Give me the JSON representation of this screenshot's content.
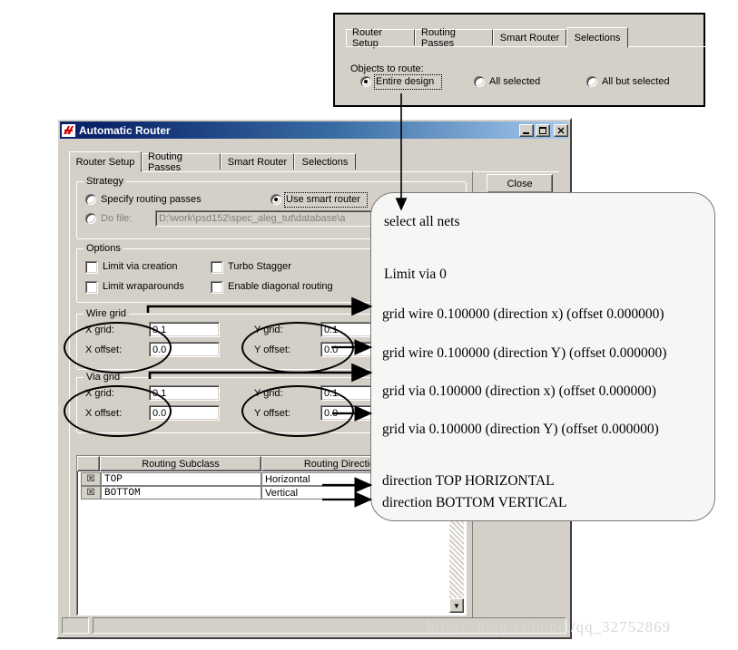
{
  "top_panel": {
    "tabs": [
      {
        "label": "Router Setup",
        "active": false
      },
      {
        "label": "Routing Passes",
        "active": false
      },
      {
        "label": "Smart Router",
        "active": false
      },
      {
        "label": "Selections",
        "active": true
      }
    ],
    "group_label": "Objects to route:",
    "options": [
      {
        "label": "Entire design",
        "selected": true
      },
      {
        "label": "All selected",
        "selected": false
      },
      {
        "label": "All but selected",
        "selected": false
      }
    ]
  },
  "dialog": {
    "title": "Automatic Router",
    "icon": "router-app-icon",
    "window_buttons": {
      "minimize": "minimize-icon",
      "maximize": "maximize-icon",
      "close": "close-icon"
    },
    "tabs": [
      {
        "label": "Router Setup",
        "active": true
      },
      {
        "label": "Routing Passes",
        "active": false
      },
      {
        "label": "Smart Router",
        "active": false
      },
      {
        "label": "Selections",
        "active": false
      }
    ],
    "close_button": "Close",
    "strategy": {
      "legend": "Strategy",
      "specify_routing_passes": "Specify routing passes",
      "use_smart_router": "Use smart router",
      "do_file_label": "Do file:",
      "do_file_value": "D:\\work\\psd152\\spec_aleg_tut\\database\\a",
      "selected": "use_smart_router"
    },
    "options": {
      "legend": "Options",
      "items": [
        {
          "label": "Limit via creation",
          "checked": false
        },
        {
          "label": "Turbo Stagger",
          "checked": false
        },
        {
          "label": "Limit wraparounds",
          "checked": false
        },
        {
          "label": "Enable diagonal routing",
          "checked": false
        }
      ]
    },
    "wire_grid": {
      "legend": "Wire grid",
      "x_grid_label": "X grid:",
      "x_grid_value": "0.1",
      "x_offset_label": "X offset:",
      "x_offset_value": "0.0",
      "y_grid_label": "Y grid:",
      "y_grid_value": "0.1",
      "y_offset_label": "Y offset:",
      "y_offset_value": "0.0"
    },
    "via_grid": {
      "legend": "Via grid",
      "x_grid_label": "X grid:",
      "x_grid_value": "0.1",
      "x_offset_label": "X offset:",
      "x_offset_value": "0.0",
      "y_grid_label": "Y grid:",
      "y_grid_value": "0.1",
      "y_offset_label": "Y offset:",
      "y_offset_value": "0.0"
    },
    "table": {
      "columns": [
        "",
        "Routing Subclass",
        "Routing Direction"
      ],
      "rows": [
        {
          "checked": "☒",
          "subclass": "TOP",
          "direction": "Horizontal"
        },
        {
          "checked": "☒",
          "subclass": "BOTTOM",
          "direction": "Vertical"
        }
      ]
    },
    "scroll_down_icon": "▼"
  },
  "callout": {
    "lines": [
      "select all nets",
      "Limit via 0",
      "grid wire 0.100000 (direction x) (offset 0.000000)",
      "grid wire 0.100000 (direction Y) (offset 0.000000)",
      "grid via 0.100000 (direction x) (offset 0.000000)",
      "grid via 0.100000 (direction Y) (offset 0.000000)",
      "direction TOP HORIZONTAL",
      "direction BOTTOM VERTICAL"
    ]
  },
  "watermark": "https://blog.csdn.net/qq_32752869",
  "colors": {
    "face": "#d4d0c8",
    "title_active_start": "#0a246a",
    "title_active_end": "#a6caf0",
    "callout_bg": "#f6f6f4",
    "field_bg": "#ffffff",
    "disabled_text": "#808080"
  }
}
